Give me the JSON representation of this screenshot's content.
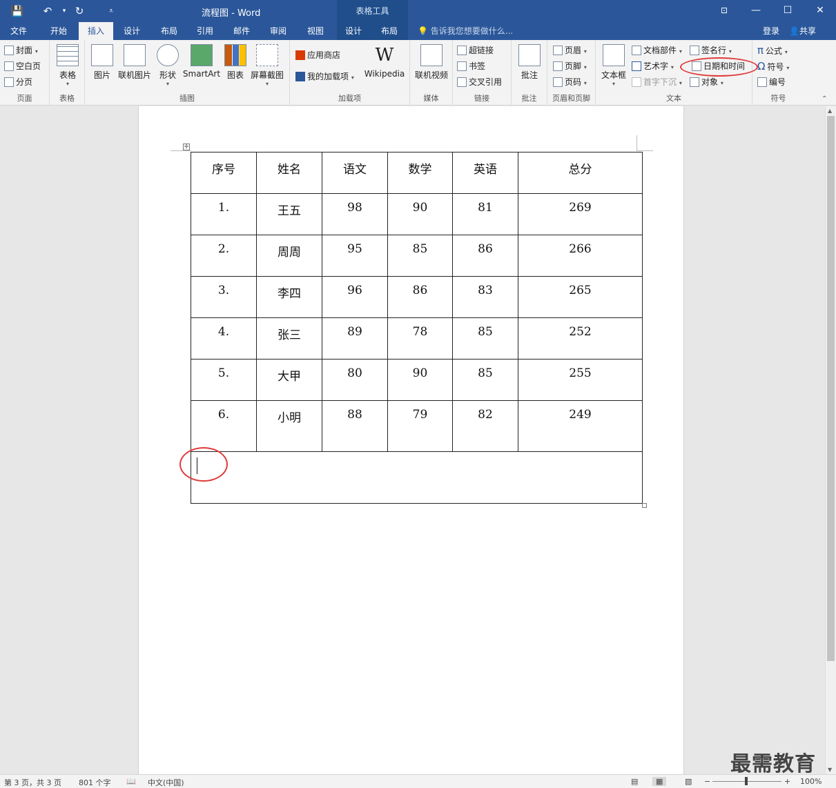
{
  "titlebar": {
    "title": "流程图 - Word",
    "context_title": "表格工具",
    "qa_save": "💾",
    "qa_undo": "↶",
    "qa_redo": "↻",
    "qa_more": "⩡"
  },
  "tabs": {
    "file": "文件",
    "home": "开始",
    "insert": "插入",
    "design": "设计",
    "layout": "布局",
    "references": "引用",
    "mailings": "邮件",
    "review": "审阅",
    "view": "视图",
    "ctx_design": "设计",
    "ctx_layout": "布局"
  },
  "tellme": "告诉我您想要做什么...",
  "login": "登录",
  "share": "共享",
  "ribbon": {
    "pages": {
      "cover": "封面",
      "blank": "空白页",
      "break": "分页",
      "label": "页面"
    },
    "tables": {
      "table": "表格",
      "label": "表格"
    },
    "illustrations": {
      "picture": "图片",
      "online_picture": "联机图片",
      "shapes": "形状",
      "smartart": "SmartArt",
      "chart": "图表",
      "screenshot": "屏幕截图",
      "label": "插图"
    },
    "addins": {
      "store": "应用商店",
      "my_addins": "我的加载项",
      "wikipedia": "Wikipedia",
      "label": "加载项"
    },
    "media": {
      "online_video": "联机视频",
      "label": "媒体"
    },
    "links": {
      "hyperlink": "超链接",
      "bookmark": "书签",
      "crossref": "交叉引用",
      "label": "链接"
    },
    "comments": {
      "comment": "批注",
      "label": "批注"
    },
    "header_footer": {
      "header": "页眉",
      "footer": "页脚",
      "page_number": "页码",
      "label": "页眉和页脚"
    },
    "text": {
      "textbox": "文本框",
      "quick_parts": "文档部件",
      "wordart": "艺术字",
      "dropcap": "首字下沉",
      "signature": "签名行",
      "datetime": "日期和时间",
      "object": "对象",
      "label": "文本"
    },
    "symbols": {
      "equation": "公式",
      "symbol": "符号",
      "numbering": "编号",
      "label": "符号"
    }
  },
  "table": {
    "headers": [
      "序号",
      "姓名",
      "语文",
      "数学",
      "英语",
      "总分"
    ],
    "rows": [
      [
        "1.",
        "王五",
        "98",
        "90",
        "81",
        "269"
      ],
      [
        "2.",
        "周周",
        "95",
        "85",
        "86",
        "266"
      ],
      [
        "3.",
        "李四",
        "96",
        "86",
        "83",
        "265"
      ],
      [
        "4.",
        "张三",
        "89",
        "78",
        "85",
        "252"
      ],
      [
        "5.",
        "大甲",
        "80",
        "90",
        "85",
        "255"
      ],
      [
        "6.",
        "小明",
        "88",
        "79",
        "82",
        "249"
      ]
    ]
  },
  "status": {
    "page": "第 3 页，共 3 页",
    "words": "801 个字",
    "language": "中文(中国)",
    "zoom": "100%"
  },
  "watermark": "最需教育",
  "colors": {
    "accent": "#2b579a",
    "highlight": "#e03a3a"
  }
}
